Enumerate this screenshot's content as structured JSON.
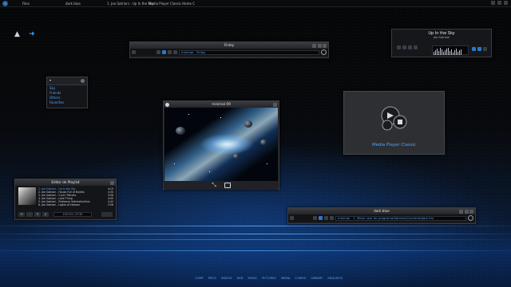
{
  "taskbar": {
    "items": [
      "Files",
      "dark blue",
      "1. Joe Satriani - Up In the Sky",
      "Media Player Classic Home C"
    ]
  },
  "top_player": {
    "title": "Finley",
    "track_label": "minimal",
    "track_text": "Finley"
  },
  "sidebar_menu": {
    "header": "▾",
    "items": [
      "Sky",
      "Friends",
      "Others",
      "Favorites"
    ]
  },
  "sky_widget": {
    "title": "Up In the Sky",
    "artist": "Joe Satriani"
  },
  "center_window": {
    "title": "minimal 09"
  },
  "mpc_panel": {
    "label": "Media Player Classic"
  },
  "playlist": {
    "title": "Editor de Playlist",
    "rows": [
      {
        "name": "1. Joe Satriani - Up In the Sky",
        "time": "4:15"
      },
      {
        "name": "2. Joe Satriani - House Full of Bullets",
        "time": "4:30"
      },
      {
        "name": "3. Joe Satriani - Cryin' Planets",
        "time": "3:56"
      },
      {
        "name": "4. Joe Satriani - Love Thing",
        "time": "4:05"
      },
      {
        "name": "5. Joe Satriani - Professor Satchafunkilus",
        "time": "4:42"
      },
      {
        "name": "6. Joe Satriani - Lights of Heaven",
        "time": "3:58"
      }
    ],
    "total": "0:37:23 / 37:33",
    "buttons": [
      "+",
      "-",
      "↑",
      "↓"
    ]
  },
  "bottom_player": {
    "title": "dark blue",
    "track_label": "minimal",
    "track_text": "1. Meus user do programa\\Satriani\\Concerts\\dark blu"
  },
  "footer_links": [
    "COMP",
    "PROG",
    "VIDEOS",
    "DVD",
    "MUSIC",
    "PICTURES",
    "MEDIA",
    "CONFIG",
    "LIBRARY",
    "ARQUIVOS"
  ],
  "colors": {
    "accent": "#4da3ff",
    "window": "#1b1c1f",
    "title": "#2a2c31"
  }
}
